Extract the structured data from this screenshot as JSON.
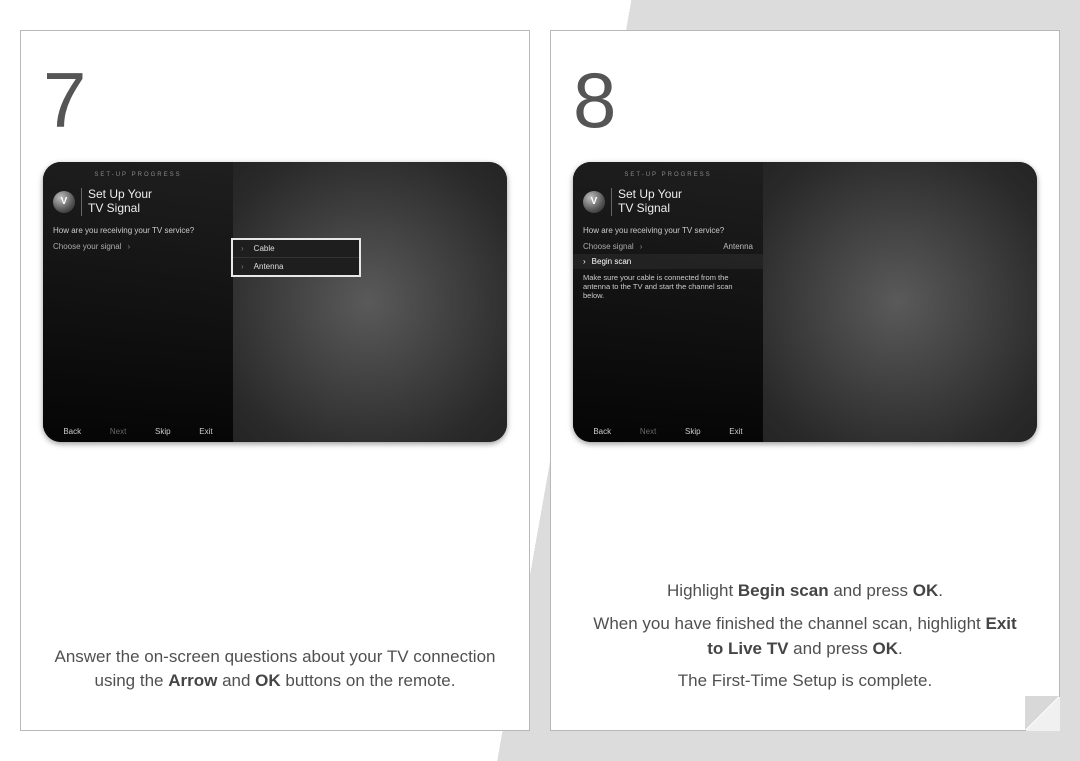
{
  "card7": {
    "number": "7",
    "tv": {
      "progress": "SET-UP PROGRESS",
      "logo": "V",
      "title_line1": "Set Up Your",
      "title_line2": "TV Signal",
      "question": "How are you receiving your TV service?",
      "row_choose": "Choose your signal",
      "popup_cable": "Cable",
      "popup_antenna": "Antenna",
      "footer_back": "Back",
      "footer_next": "Next",
      "footer_skip": "Skip",
      "footer_exit": "Exit"
    },
    "caption_p1_a": "Answer the on-screen questions about your TV connection using the ",
    "caption_b1": "Arrow",
    "caption_mid": " and ",
    "caption_b2": "OK",
    "caption_p1_b": " buttons on the remote."
  },
  "card8": {
    "number": "8",
    "tv": {
      "progress": "SET-UP PROGRESS",
      "logo": "V",
      "title_line1": "Set Up Your",
      "title_line2": "TV Signal",
      "question": "How are you receiving your TV service?",
      "row_choose_label": "Choose signal",
      "row_choose_value": "Antenna",
      "row_begin": "Begin scan",
      "note": "Make sure your cable is connected from the antenna to the TV and start the channel scan below.",
      "footer_back": "Back",
      "footer_next": "Next",
      "footer_skip": "Skip",
      "footer_exit": "Exit"
    },
    "line1_a": "Highlight ",
    "line1_b1": "Begin scan",
    "line1_mid": " and press ",
    "line1_b2": "OK",
    "line1_end": ".",
    "line2_a": "When you have finished the channel scan, highlight ",
    "line2_b1": "Exit to Live TV",
    "line2_mid": " and press ",
    "line2_b2": "OK",
    "line2_end": ".",
    "line3": "The First-Time Setup is complete."
  }
}
